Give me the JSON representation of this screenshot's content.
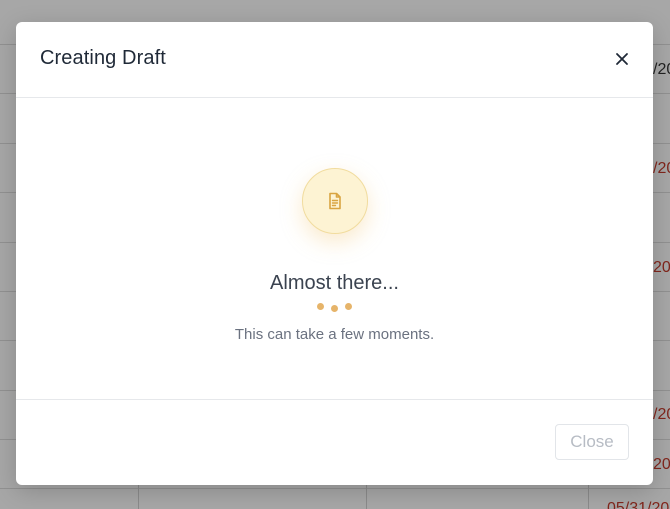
{
  "background": {
    "cells": [
      {
        "text": "/20",
        "red": false
      },
      {
        "text": "/20",
        "red": true
      },
      {
        "text": "20",
        "red": true
      },
      {
        "text": "/20",
        "red": true
      },
      {
        "text": "20",
        "red": true
      },
      {
        "text": "05/31/20",
        "red": true
      }
    ]
  },
  "modal": {
    "title": "Creating Draft",
    "close_icon": "close-icon",
    "status_icon": "document-icon",
    "status_title": "Almost there...",
    "status_subtitle": "This can take a few moments.",
    "close_button_label": "Close",
    "accent_color": "#e6b46a"
  }
}
